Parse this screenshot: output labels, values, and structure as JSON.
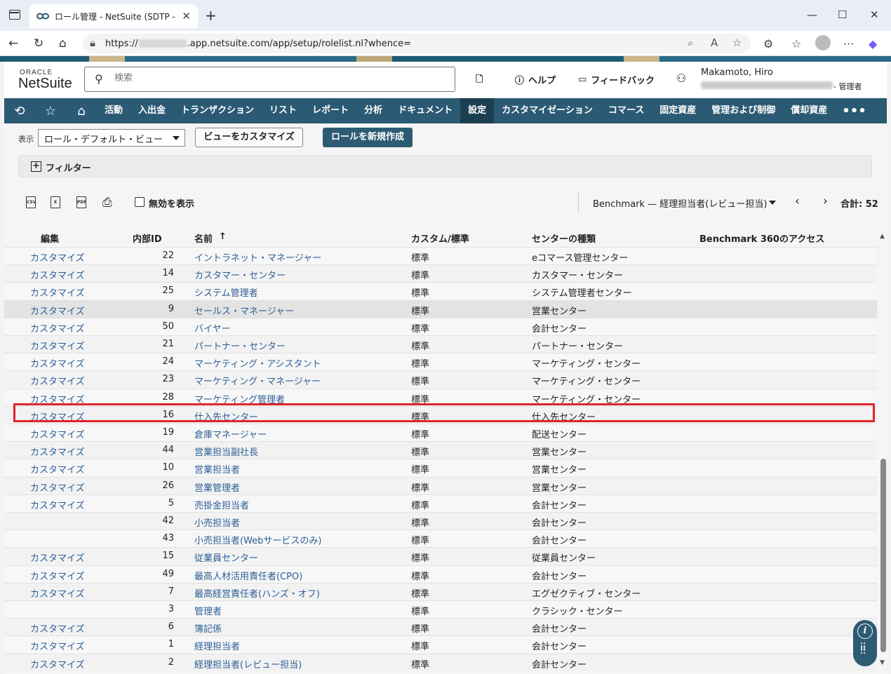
{
  "browser": {
    "tab_title": "ロール管理 - NetSuite (SDTP - SS FI",
    "url_prefix": "https://",
    "url_suffix": ".app.netsuite.com/app/setup/rolelist.nl?whence="
  },
  "header": {
    "oracle": "ORACLE",
    "netsuite": "NetSuite",
    "search_placeholder": "検索",
    "help": "ヘルプ",
    "feedback": "フィードバック",
    "user_name": "Makamoto, Hiro",
    "user_role": "- 管理者"
  },
  "menu": [
    "活動",
    "入出金",
    "トランザクション",
    "リスト",
    "レポート",
    "分析",
    "ドキュメント",
    "設定",
    "カスタマイゼーション",
    "コマース",
    "固定資産",
    "管理および制御",
    "償却資産"
  ],
  "menu_active": "設定",
  "view": {
    "label": "表示",
    "selected": "ロール・デフォルト・ビュー",
    "customize_btn": "ビューをカスタマイズ",
    "new_btn": "ロールを新規作成",
    "filter": "フィルター"
  },
  "toolbar": {
    "csv": "CSV",
    "xls": "X",
    "pdf": "PDF",
    "show_inactive": "無効を表示",
    "page_select": "Benchmark — 経理担当者(レビュー担当)",
    "total": "合計: 52"
  },
  "table": {
    "headers": [
      "編集",
      "内部ID",
      "名前",
      "↑",
      "カスタム/標準",
      "センターの種類",
      "Benchmark 360のアクセス"
    ],
    "rows": [
      {
        "edit": "カスタマイズ",
        "id": "22",
        "name": "イントラネット・マネージャー",
        "type": "標準",
        "center": "eコマース管理センター"
      },
      {
        "edit": "カスタマイズ",
        "id": "14",
        "name": "カスタマー・センター",
        "type": "標準",
        "center": "カスタマー・センター"
      },
      {
        "edit": "カスタマイズ",
        "id": "25",
        "name": "システム管理者",
        "type": "標準",
        "center": "システム管理者センター"
      },
      {
        "edit": "カスタマイズ",
        "id": "9",
        "name": "セールス・マネージャー",
        "type": "標準",
        "center": "営業センター"
      },
      {
        "edit": "カスタマイズ",
        "id": "50",
        "name": "バイヤー",
        "type": "標準",
        "center": "会計センター"
      },
      {
        "edit": "カスタマイズ",
        "id": "21",
        "name": "パートナー・センター",
        "type": "標準",
        "center": "パートナー・センター"
      },
      {
        "edit": "カスタマイズ",
        "id": "24",
        "name": "マーケティング・アシスタント",
        "type": "標準",
        "center": "マーケティング・センター"
      },
      {
        "edit": "カスタマイズ",
        "id": "23",
        "name": "マーケティング・マネージャー",
        "type": "標準",
        "center": "マーケティング・センター"
      },
      {
        "edit": "カスタマイズ",
        "id": "28",
        "name": "マーケティング管理者",
        "type": "標準",
        "center": "マーケティング・センター"
      },
      {
        "edit": "カスタマイズ",
        "id": "16",
        "name": "仕入先センター",
        "type": "標準",
        "center": "仕入先センター"
      },
      {
        "edit": "カスタマイズ",
        "id": "19",
        "name": "倉庫マネージャー",
        "type": "標準",
        "center": "配送センター"
      },
      {
        "edit": "カスタマイズ",
        "id": "44",
        "name": "営業担当副社長",
        "type": "標準",
        "center": "営業センター"
      },
      {
        "edit": "カスタマイズ",
        "id": "10",
        "name": "営業担当者",
        "type": "標準",
        "center": "営業センター"
      },
      {
        "edit": "カスタマイズ",
        "id": "26",
        "name": "営業管理者",
        "type": "標準",
        "center": "営業センター"
      },
      {
        "edit": "カスタマイズ",
        "id": "5",
        "name": "売掛金担当者",
        "type": "標準",
        "center": "会計センター"
      },
      {
        "edit": "",
        "id": "42",
        "name": "小売担当者",
        "type": "標準",
        "center": "会計センター"
      },
      {
        "edit": "",
        "id": "43",
        "name": "小売担当者(Webサービスのみ)",
        "type": "標準",
        "center": "会計センター"
      },
      {
        "edit": "カスタマイズ",
        "id": "15",
        "name": "従業員センター",
        "type": "標準",
        "center": "従業員センター"
      },
      {
        "edit": "カスタマイズ",
        "id": "49",
        "name": "最高人材活用責任者(CPO)",
        "type": "標準",
        "center": "会計センター"
      },
      {
        "edit": "カスタマイズ",
        "id": "7",
        "name": "最高経営責任者(ハンズ・オフ)",
        "type": "標準",
        "center": "エグゼクティブ・センター"
      },
      {
        "edit": "",
        "id": "3",
        "name": "管理者",
        "type": "標準",
        "center": "クラシック・センター"
      },
      {
        "edit": "カスタマイズ",
        "id": "6",
        "name": "簿記係",
        "type": "標準",
        "center": "会計センター"
      },
      {
        "edit": "カスタマイズ",
        "id": "1",
        "name": "経理担当者",
        "type": "標準",
        "center": "会計センター"
      },
      {
        "edit": "カスタマイズ",
        "id": "2",
        "name": "経理担当者(レビュー担当)",
        "type": "標準",
        "center": "会計センター"
      }
    ]
  },
  "colors": {
    "menu_bg": "#2b5a74",
    "link": "#2b5e96",
    "highlight": "#e0222a"
  }
}
